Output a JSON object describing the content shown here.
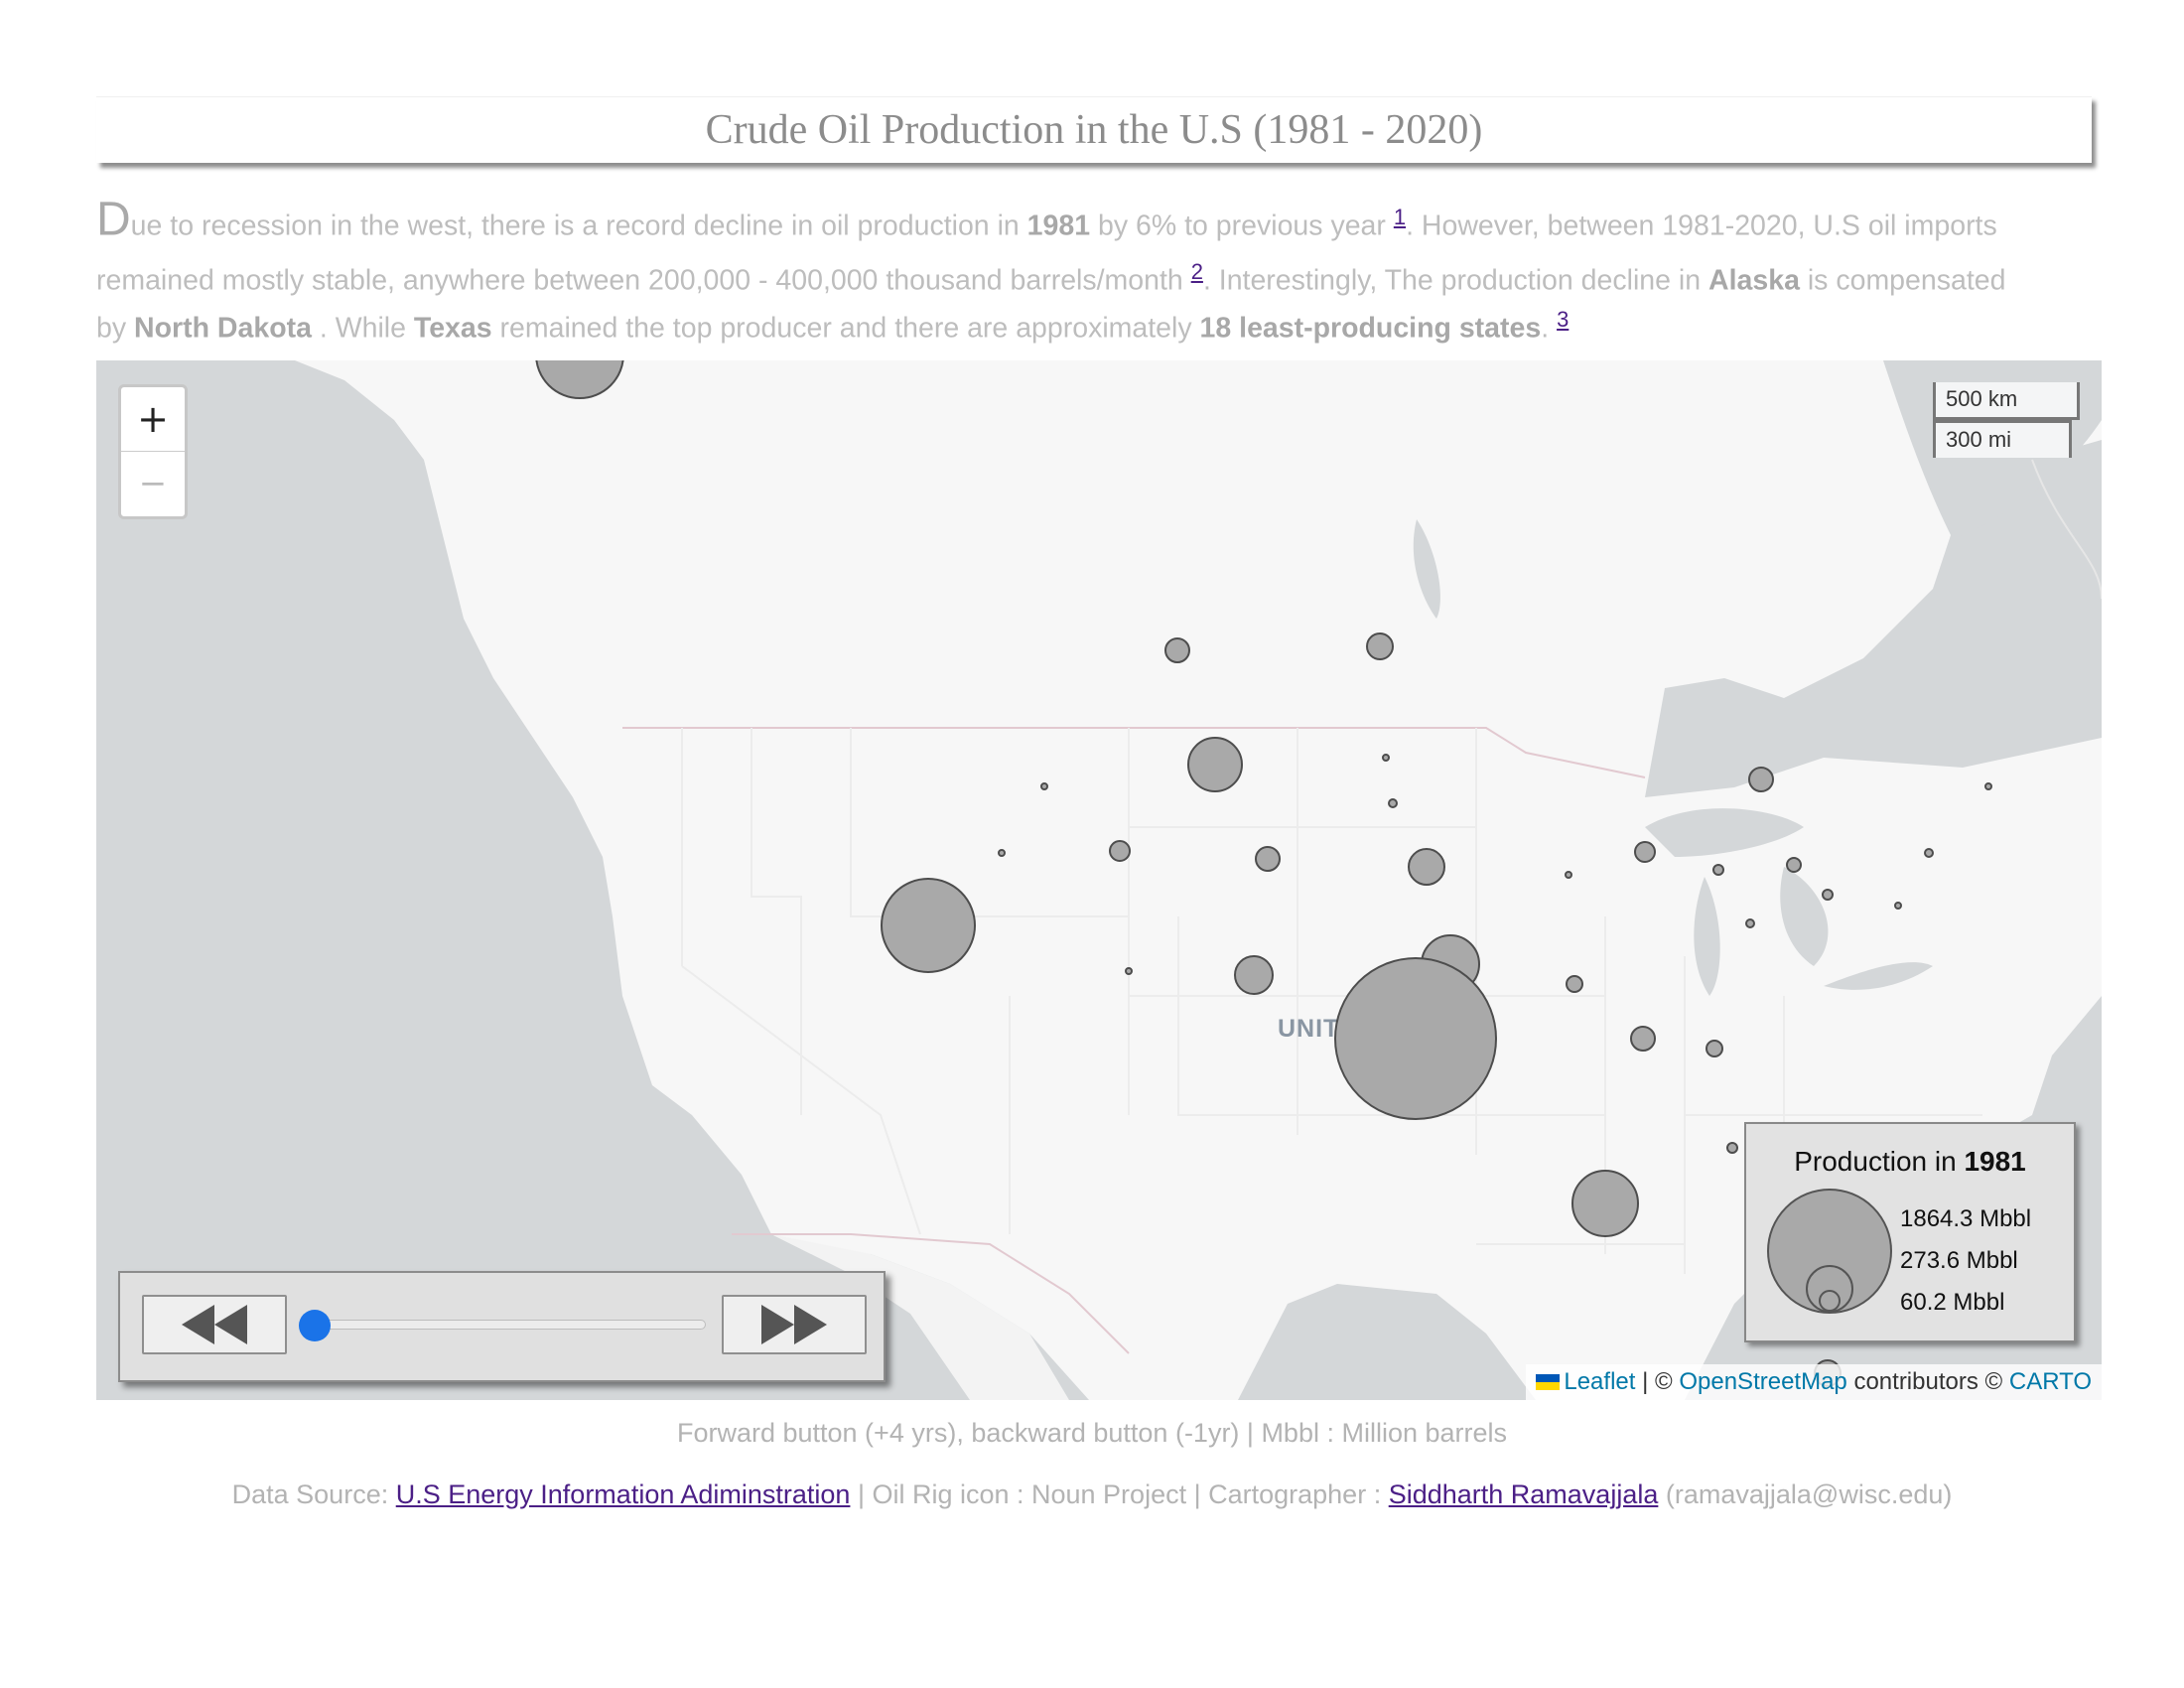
{
  "page": {
    "title": "Crude Oil Production in the U.S (1981 - 2020)"
  },
  "intro": {
    "dropcap": "D",
    "seg1": "ue to recession in the west, there is a record decline in oil production in ",
    "b1": "1981",
    "seg2": " by 6% to previous year ",
    "ref1": "1",
    "seg3": ". However, between 1981-2020, U.S oil imports",
    "seg4": "remained mostly stable, anywhere between 200,000 - 400,000 thousand barrels/month ",
    "ref2": "2",
    "seg5": ". Interestingly, The production decline in ",
    "b2": "Alaska",
    "seg6": " is compensated",
    "seg7": "by ",
    "b3": "North Dakota",
    "seg8": " . While ",
    "b4": "Texas",
    "seg9": " remained the top producer and there are approximately ",
    "b5": "18 least-producing states",
    "seg10": ". ",
    "ref3": "3"
  },
  "map": {
    "country_label": "UNITED STATES",
    "zoom_in": "+",
    "zoom_out": "−",
    "scale_km": "500 km",
    "scale_mi": "300 mi",
    "water_color": "#d4d7d9",
    "land_color": "#f7f7f7",
    "symbol_color": "#a9a9a9",
    "attribution": {
      "leaflet": "Leaflet",
      "sep1": " | © ",
      "osm": "OpenStreetMap",
      "mid": " contributors © ",
      "carto": "CARTO"
    }
  },
  "legend": {
    "title_prefix": "Production in ",
    "year": "1981",
    "values": [
      "1864.3 Mbbl",
      "273.6 Mbbl",
      "60.2 Mbbl"
    ]
  },
  "player": {
    "back_icon": "rewind-icon",
    "forward_icon": "fast-forward-icon",
    "slider_position": 0
  },
  "footer": {
    "caption": "Forward button (+4 yrs), backward button (-1yr) | Mbbl : Million barrels",
    "source_prefix": "Data Source: ",
    "source_link": "U.S Energy Information Adiminstration",
    "source_mid": " | Oil Rig icon : Noun Project | Cartographer : ",
    "cartographer": "Siddharth Ramavajjala",
    "email": " (ramavajjala@wisc.edu)"
  }
}
